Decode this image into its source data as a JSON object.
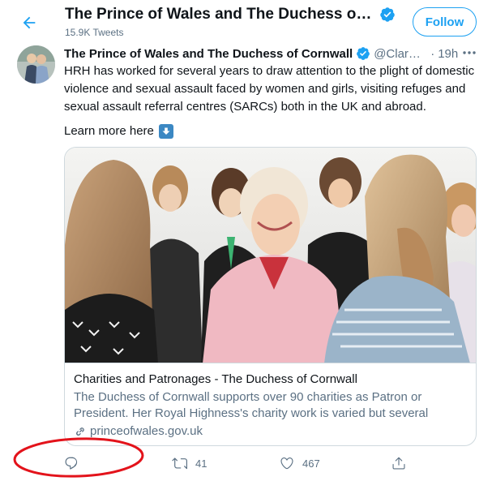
{
  "header": {
    "title": "The Prince of Wales and The Duchess of Cornwall",
    "subtitle": "15.9K Tweets",
    "follow_label": "Follow"
  },
  "tweet": {
    "author_name": "The Prince of Wales and The Duchess of Cornwall",
    "handle": "@ClarenceHouse",
    "time": "19h",
    "text": "HRH has worked for several years to draw attention to the plight of domestic violence and sexual assault faced by women and girls, visiting refuges and sexual assault referral centres (SARCs) both in the UK and abroad.",
    "learn_more": "Learn more here"
  },
  "card": {
    "title": "Charities and Patronages - The Duchess of Cornwall",
    "description": "The Duchess of Cornwall supports over 90 charities as Patron or President. Her Royal Highness's charity work is varied but several themes...",
    "domain": "princeofwales.gov.uk"
  },
  "actions": {
    "reply_count": "",
    "retweet_count": "41",
    "like_count": "467"
  },
  "colors": {
    "accent": "#1da1f2",
    "muted": "#5b7083",
    "annotation": "#e3131b"
  },
  "icons": [
    "back-arrow-icon",
    "verified-badge-icon",
    "more-icon",
    "down-arrow-emoji-icon",
    "link-icon",
    "reply-icon",
    "retweet-icon",
    "like-icon",
    "share-icon"
  ]
}
